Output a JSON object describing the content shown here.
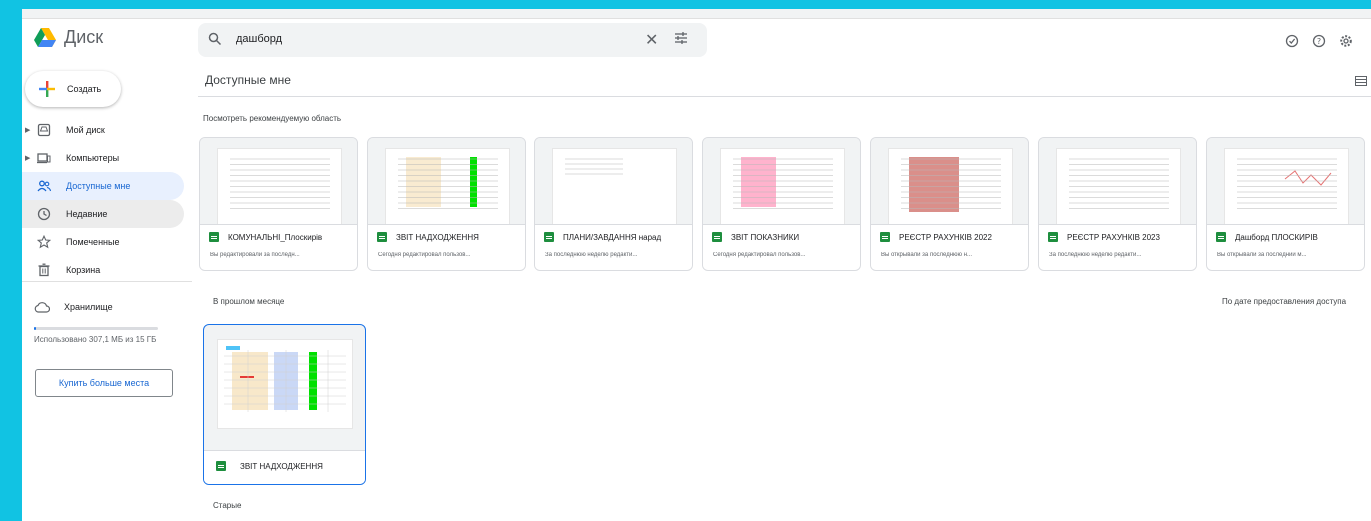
{
  "app": {
    "name": "Диск"
  },
  "search": {
    "value": "дашборд"
  },
  "sidebar": {
    "create_label": "Создать",
    "items": [
      {
        "label": "Мой диск"
      },
      {
        "label": "Компьютеры"
      },
      {
        "label": "Доступные мне"
      },
      {
        "label": "Недавние"
      },
      {
        "label": "Помеченные"
      },
      {
        "label": "Корзина"
      }
    ],
    "storage_label": "Хранилище",
    "storage_used_fraction": 0.02,
    "storage_text": "Использовано 307,1 МБ из 15 ГБ",
    "buy_label": "Купить больше места"
  },
  "main": {
    "title": "Доступные мне",
    "suggested_label": "Посмотреть рекомендуемую область",
    "suggested": [
      {
        "name": "КОМУНАЛЬНІ_Плоскирів",
        "sub": "Вы редактировали за последн..."
      },
      {
        "name": "ЗВІТ НАДХОДЖЕННЯ",
        "sub": "Сегодня редактировал пользов..."
      },
      {
        "name": "ПЛАНИ/ЗАВДАННЯ нарад",
        "sub": "За последнюю неделю редакти..."
      },
      {
        "name": "ЗВІТ ПОКАЗНИКИ",
        "sub": "Сегодня редактировал пользов..."
      },
      {
        "name": "РЕЄСТР РАХУНКІВ 2022",
        "sub": "Вы открывали за последнюю н..."
      },
      {
        "name": "РЕЄСТР РАХУНКІВ 2023",
        "sub": "За последнюю неделю редакти..."
      },
      {
        "name": "Дашборд ПЛОСКИРІВ",
        "sub": "Вы открывали за последний м..."
      }
    ],
    "last_month_label": "В прошлом месяце",
    "sort_label": "По дате предоставления доступа",
    "last_month": [
      {
        "name": "ЗВІТ НАДХОДЖЕННЯ"
      }
    ],
    "older_label": "Старые"
  },
  "colors": {
    "accent": "#1a73e8",
    "sheets": "#1e8e3e",
    "frame": "#11c3e3"
  }
}
